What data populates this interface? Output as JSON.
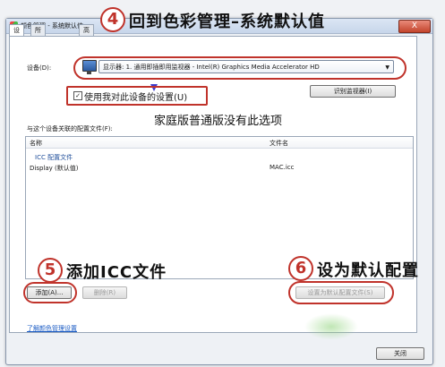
{
  "window": {
    "title": "颜色管理 - 系统默认值",
    "close_label": "X"
  },
  "tabs": [
    {
      "label": "设备"
    },
    {
      "label": "所有配置文件"
    },
    {
      "label": "高级"
    }
  ],
  "device": {
    "label": "设备(D):",
    "selected": "显示器: 1. 通用即插即用监视器 - Intel(R) Graphics Media Accelerator HD",
    "identify_button": "识别监视器(I)"
  },
  "use_settings": {
    "checked": true,
    "check_mark": "✓",
    "label": "使用我对此设备的设置(U)"
  },
  "profiles": {
    "section_label": "与这个设备关联的配置文件(F):",
    "columns": [
      "名称",
      "文件名"
    ],
    "group": "ICC 配置文件",
    "rows": [
      {
        "name": "Display (默认值)",
        "file": "MAC.icc"
      }
    ]
  },
  "buttons": {
    "add": "添加(A)...",
    "remove": "删除(R)",
    "set_default": "设置为默认配置文件(S)",
    "close": "关闭"
  },
  "link": "了解颜色管理设置",
  "annotations": {
    "step4_num": "4",
    "step4_text": "回到色彩管理–系统默认值",
    "note": "家庭版普通版没有此选项",
    "step5_num": "5",
    "step5_text": "添加ICC文件",
    "step6_num": "6",
    "step6_text": "设为默认配置"
  },
  "colors": {
    "highlight": "#c0332b",
    "link": "#1a5bc4"
  }
}
